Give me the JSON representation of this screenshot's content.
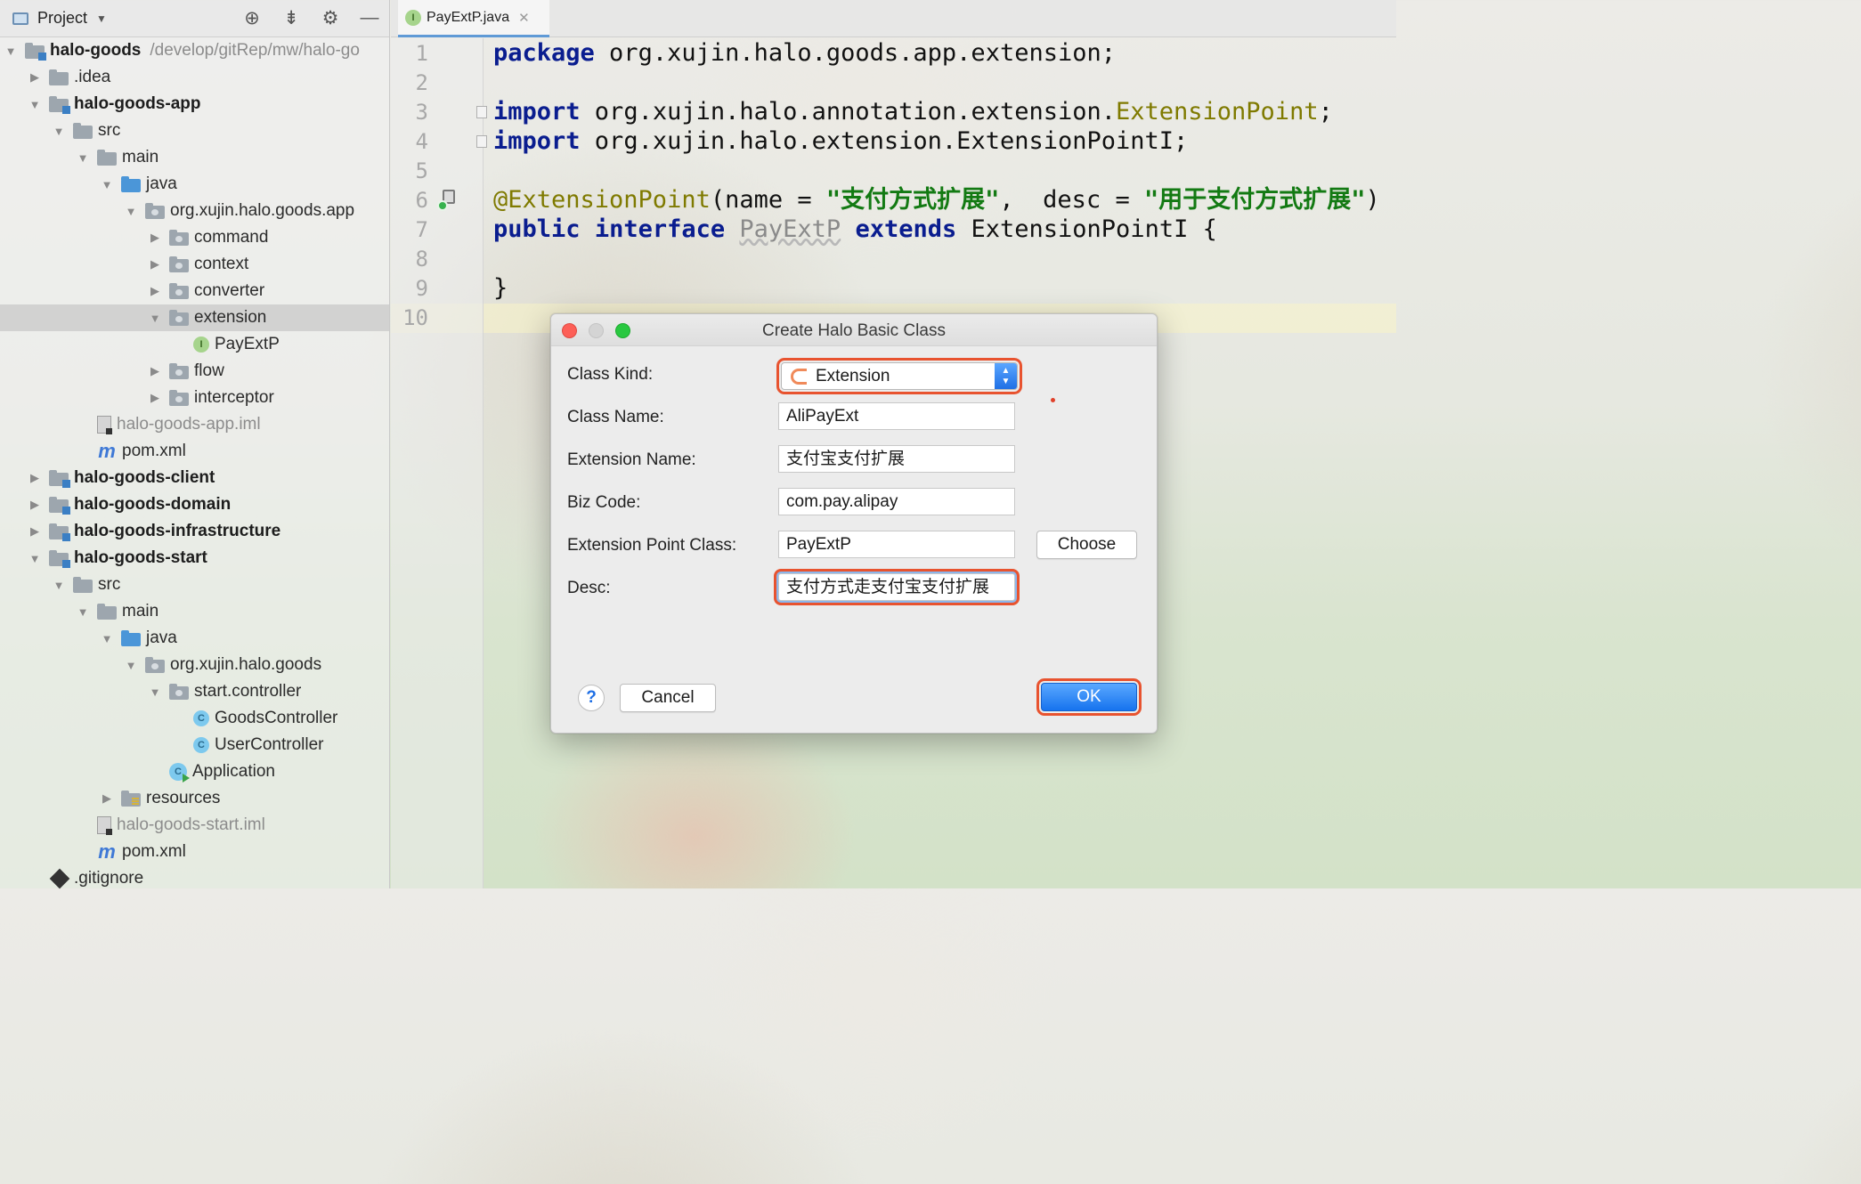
{
  "project_panel": {
    "title": "Project",
    "tools": [
      "locate-icon",
      "collapse-icon",
      "gear-icon",
      "minimize-icon"
    ],
    "tree": [
      {
        "label": "halo-goods",
        "path": "/develop/gitRep/mw/halo-go",
        "icon": "module",
        "depth": 0,
        "expanded": true,
        "bold": true
      },
      {
        "label": ".idea",
        "icon": "folder",
        "depth": 1,
        "expanded": false
      },
      {
        "label": "halo-goods-app",
        "icon": "module",
        "depth": 1,
        "expanded": true,
        "bold": true
      },
      {
        "label": "src",
        "icon": "folder",
        "depth": 2,
        "expanded": true
      },
      {
        "label": "main",
        "icon": "folder",
        "depth": 3,
        "expanded": true
      },
      {
        "label": "java",
        "icon": "folder-blue",
        "depth": 4,
        "expanded": true
      },
      {
        "label": "org.xujin.halo.goods.app",
        "icon": "pkg",
        "depth": 5,
        "expanded": true
      },
      {
        "label": "command",
        "icon": "pkg",
        "depth": 6,
        "expanded": false
      },
      {
        "label": "context",
        "icon": "pkg",
        "depth": 6,
        "expanded": false
      },
      {
        "label": "converter",
        "icon": "pkg",
        "depth": 6,
        "expanded": false
      },
      {
        "label": "extension",
        "icon": "pkg",
        "depth": 6,
        "expanded": true,
        "selected": true
      },
      {
        "label": "PayExtP",
        "icon": "iface",
        "depth": 7
      },
      {
        "label": "flow",
        "icon": "pkg",
        "depth": 6,
        "expanded": false
      },
      {
        "label": "interceptor",
        "icon": "pkg",
        "depth": 6,
        "expanded": false
      },
      {
        "label": "halo-goods-app.iml",
        "icon": "file",
        "depth": 3,
        "muted": true
      },
      {
        "label": "pom.xml",
        "icon": "mvn",
        "depth": 3
      },
      {
        "label": "halo-goods-client",
        "icon": "module",
        "depth": 1,
        "expanded": false,
        "bold": true
      },
      {
        "label": "halo-goods-domain",
        "icon": "module",
        "depth": 1,
        "expanded": false,
        "bold": true
      },
      {
        "label": "halo-goods-infrastructure",
        "icon": "module",
        "depth": 1,
        "expanded": false,
        "bold": true
      },
      {
        "label": "halo-goods-start",
        "icon": "module",
        "depth": 1,
        "expanded": true,
        "bold": true
      },
      {
        "label": "src",
        "icon": "folder",
        "depth": 2,
        "expanded": true
      },
      {
        "label": "main",
        "icon": "folder",
        "depth": 3,
        "expanded": true
      },
      {
        "label": "java",
        "icon": "folder-blue",
        "depth": 4,
        "expanded": true
      },
      {
        "label": "org.xujin.halo.goods",
        "icon": "pkg",
        "depth": 5,
        "expanded": true
      },
      {
        "label": "start.controller",
        "icon": "pkg",
        "depth": 6,
        "expanded": true
      },
      {
        "label": "GoodsController",
        "icon": "cls",
        "depth": 7
      },
      {
        "label": "UserController",
        "icon": "cls",
        "depth": 7
      },
      {
        "label": "Application",
        "icon": "app",
        "depth": 6
      },
      {
        "label": "resources",
        "icon": "res",
        "depth": 4,
        "expanded": false
      },
      {
        "label": "halo-goods-start.iml",
        "icon": "file",
        "depth": 3,
        "muted": true
      },
      {
        "label": "pom.xml",
        "icon": "mvn",
        "depth": 3
      },
      {
        "label": ".gitignore",
        "icon": "git",
        "depth": 1
      }
    ]
  },
  "editor": {
    "tab": {
      "label": "PayExtP.java",
      "icon_letter": "I"
    },
    "line_numbers": [
      "1",
      "2",
      "3",
      "4",
      "5",
      "6",
      "7",
      "8",
      "9",
      "10"
    ],
    "code": {
      "l1_kw": "package",
      "l1_rest": " org.xujin.halo.goods.app.extension;",
      "l3_kw": "import",
      "l3_rest": " org.xujin.halo.annotation.extension.",
      "l3_ann": "ExtensionPoint",
      "l3_end": ";",
      "l4_kw": "import",
      "l4_rest": " org.xujin.halo.extension.ExtensionPointI;",
      "l6_ann": "@ExtensionPoint",
      "l6_a": "(name = ",
      "l6_s1": "\"支付方式扩展\"",
      "l6_b": ",  desc = ",
      "l6_s2": "\"用于支付方式扩展\"",
      "l6_c": ")",
      "l7_kw1": "public",
      "l7_kw2": "interface",
      "l7_name": "PayExtP",
      "l7_kw3": "extends",
      "l7_rest": " ExtensionPointI {",
      "l9": "}"
    }
  },
  "dialog": {
    "title": "Create Halo Basic Class",
    "class_kind_label": "Class Kind:",
    "class_kind_value": "Extension",
    "class_name_label": "Class  Name:",
    "class_name_value": "AliPayExt",
    "extension_name_label": "Extension Name:",
    "extension_name_value": "支付宝支付扩展",
    "biz_code_label": "Biz Code:",
    "biz_code_value": "com.pay.alipay",
    "ext_point_label": "Extension Point Class:",
    "ext_point_value": "PayExtP",
    "choose_label": "Choose",
    "desc_label": "Desc:",
    "desc_value": "支付方式走支付宝支付扩展",
    "help_label": "?",
    "cancel_label": "Cancel",
    "ok_label": "OK"
  },
  "colors": {
    "highlight_ring": "#e8532f",
    "accent_blue": "#1673ee",
    "keyword": "#0a1d8f",
    "string": "#137a13",
    "annotation": "#7f7a00"
  }
}
